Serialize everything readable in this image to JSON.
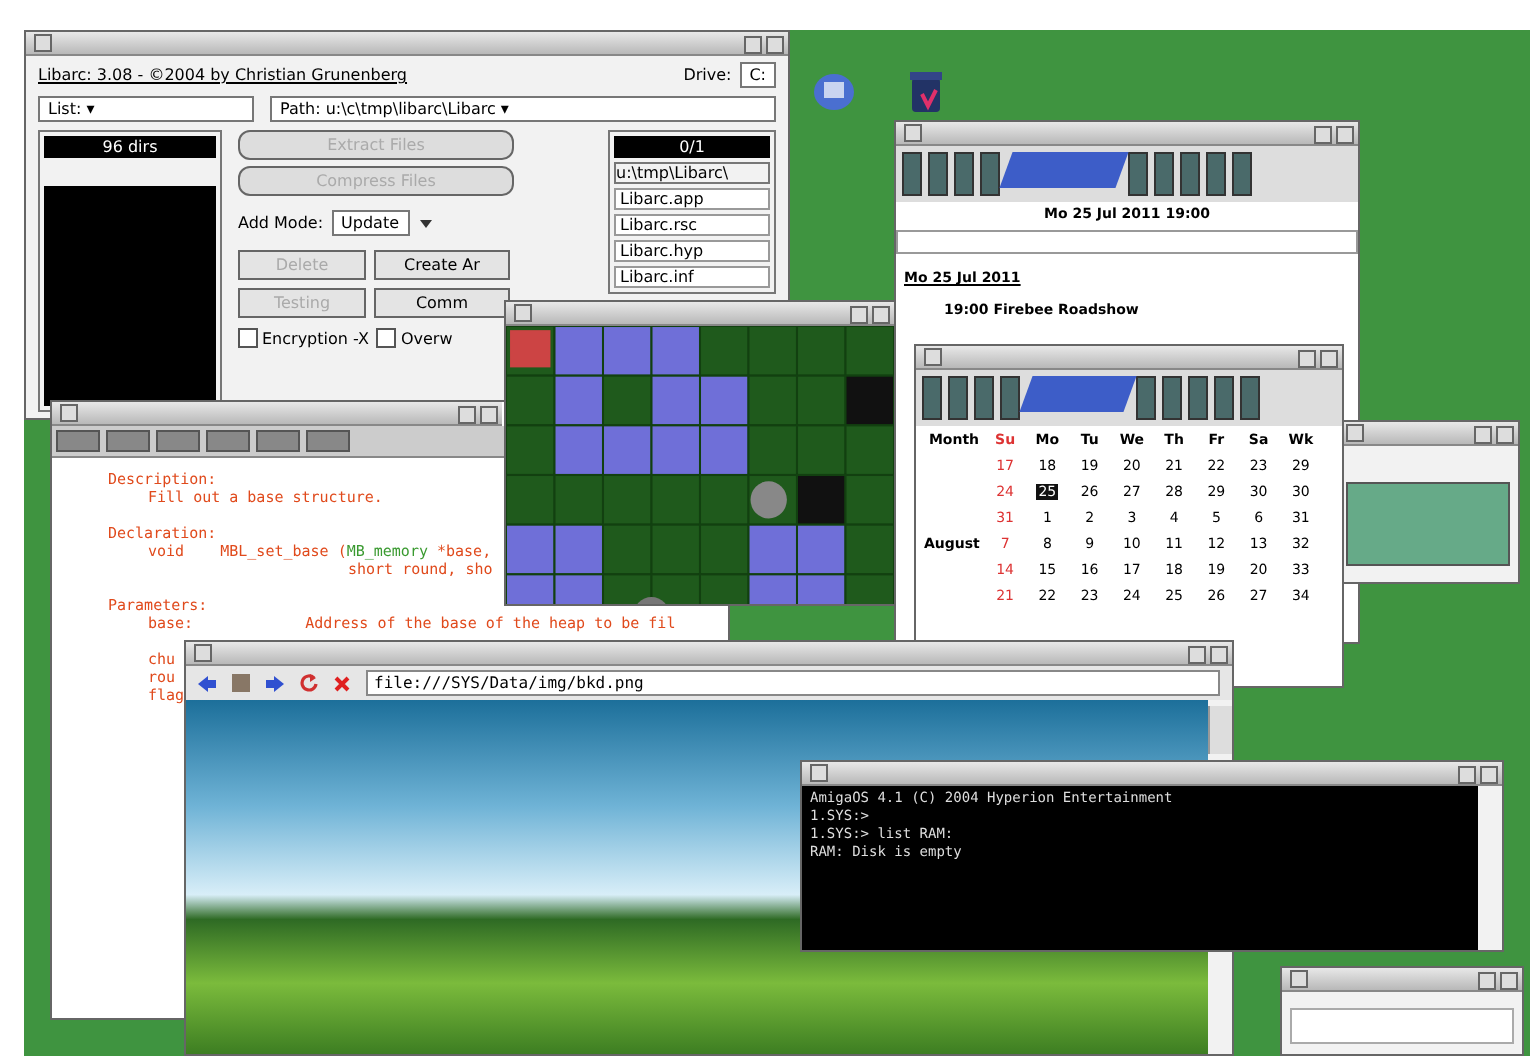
{
  "archiver": {
    "info": "Libarc: 3.08 - ©2004 by Christian Grunenberg",
    "drive_label": "Drive:",
    "drive_value": "C:",
    "list_field": "List: ▾",
    "path_field": "Path: u:\\c\\tmp\\libarc\\Libarc ▾",
    "left_list_header": "96 dirs",
    "right_list_header": "0/1",
    "right_list_path": "u:\\tmp\\Libarc\\",
    "right_list_items": [
      "Libarc.app",
      "Libarc.rsc",
      "Libarc.hyp",
      "Libarc.inf"
    ],
    "actions": [
      {
        "label": "Extract Files",
        "disabled": true
      },
      {
        "label": "Compress Files",
        "disabled": true
      }
    ],
    "add_mode_label": "Add Mode:",
    "add_mode_value": "Update",
    "buttons": [
      {
        "label": "Delete",
        "disabled": true
      },
      {
        "label": "Create Ar",
        "disabled": false
      },
      {
        "label": "Testing",
        "disabled": true
      },
      {
        "label": "Comm",
        "disabled": false
      }
    ],
    "options": [
      {
        "label": "Encryption -X",
        "checked": false
      },
      {
        "label": "Overw",
        "checked": false
      }
    ]
  },
  "editor": {
    "lines": [
      {
        "kind": "heading",
        "text": "Description:"
      },
      {
        "kind": "body",
        "text": "Fill out a base structure."
      },
      {
        "kind": "gap"
      },
      {
        "kind": "heading",
        "text": "Declaration:"
      },
      {
        "kind": "decl",
        "keyword": "void",
        "name": "MBL_set_base (",
        "type": "MB_memory",
        "rest": "*base,"
      },
      {
        "kind": "cont",
        "text": "short round, sho"
      },
      {
        "kind": "gap"
      },
      {
        "kind": "heading",
        "text": "Parameters:"
      },
      {
        "kind": "param",
        "name": "base:",
        "text": "Address of the base of the heap to be fil"
      },
      {
        "kind": "gap"
      },
      {
        "kind": "param",
        "name": "chu"
      },
      {
        "kind": "param",
        "name": "rou"
      },
      {
        "kind": "param",
        "name": "flag"
      }
    ]
  },
  "calendar_day": {
    "date_line": "Mo 25 Jul 2011  19:00",
    "day_heading": "Mo 25 Jul 2011",
    "entries": [
      "19:00 Firebee Roadshow"
    ]
  },
  "calendar_month": {
    "columns": [
      "Month",
      "Su",
      "Mo",
      "Tu",
      "We",
      "Th",
      "Fr",
      "Sa",
      "Wk"
    ],
    "rows": [
      {
        "days": [
          {
            "d": "17",
            "today": false
          },
          {
            "d": "18",
            "today": false
          },
          {
            "d": "19",
            "today": false
          },
          {
            "d": "20",
            "today": false
          },
          {
            "d": "21",
            "today": false
          },
          {
            "d": "22",
            "today": false
          },
          {
            "d": "23",
            "today": false
          }
        ],
        "week": "29"
      },
      {
        "days": [
          {
            "d": "24",
            "today": false
          },
          {
            "d": "25",
            "today": true
          },
          {
            "d": "26",
            "today": false
          },
          {
            "d": "27",
            "today": false
          },
          {
            "d": "28",
            "today": false
          },
          {
            "d": "29",
            "today": false
          },
          {
            "d": "30",
            "today": false
          }
        ],
        "week": "30"
      },
      {
        "days": [
          {
            "d": "31",
            "today": false
          },
          {
            "d": "1",
            "today": false
          },
          {
            "d": "2",
            "today": false
          },
          {
            "d": "3",
            "today": false
          },
          {
            "d": "4",
            "today": false
          },
          {
            "d": "5",
            "today": false
          },
          {
            "d": "6",
            "today": false
          }
        ],
        "week": "31"
      },
      {
        "month": "August",
        "days": [
          {
            "d": "7",
            "today": false
          },
          {
            "d": "8",
            "today": false
          },
          {
            "d": "9",
            "today": false
          },
          {
            "d": "10",
            "today": false
          },
          {
            "d": "11",
            "today": false
          },
          {
            "d": "12",
            "today": false
          },
          {
            "d": "13",
            "today": false
          }
        ],
        "week": "32"
      },
      {
        "days": [
          {
            "d": "14",
            "today": false
          },
          {
            "d": "15",
            "today": false
          },
          {
            "d": "16",
            "today": false
          },
          {
            "d": "17",
            "today": false
          },
          {
            "d": "18",
            "today": false
          },
          {
            "d": "19",
            "today": false
          },
          {
            "d": "20",
            "today": false
          }
        ],
        "week": "33"
      },
      {
        "days": [
          {
            "d": "21",
            "today": false
          },
          {
            "d": "22",
            "today": false
          },
          {
            "d": "23",
            "today": false
          },
          {
            "d": "24",
            "today": false
          },
          {
            "d": "25",
            "today": false
          },
          {
            "d": "26",
            "today": false
          },
          {
            "d": "27",
            "today": false
          }
        ],
        "week": "34"
      }
    ]
  },
  "browser": {
    "url": "file:///SYS/Data/img/bkd.png"
  },
  "shell": {
    "lines": [
      "AmigaOS 4.1 (C) 2004 Hyperion Entertainment",
      "1.SYS:>",
      "1.SYS:> list RAM:",
      "RAM: Disk is empty"
    ]
  }
}
